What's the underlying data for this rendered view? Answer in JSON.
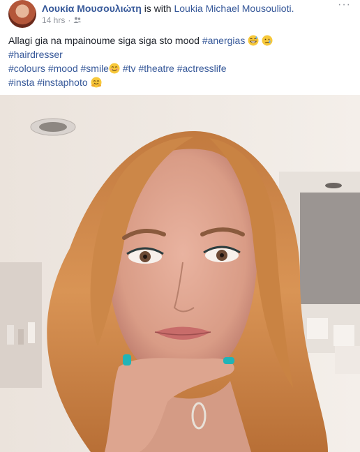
{
  "post": {
    "author_name": "Λουκία Μουσουλιώτη",
    "with_text": "is with",
    "tagged_name": "Loukia Michael Mousoulioti.",
    "timestamp": "14 hrs",
    "separator": "·",
    "privacy_icon": "friends-icon",
    "more_icon": "more-icon",
    "more_label": "···"
  },
  "text": {
    "line1_plain": "Allagi gia na mpainoume siga siga sto mood ",
    "line1_tag": "#anergias",
    "line1_emojis": [
      "grinning-sweat-emoji",
      "crying-emoji"
    ],
    "line2_tags": [
      "#hairdresser"
    ],
    "line3_tags": [
      "#colours",
      "#mood",
      "#smile"
    ],
    "line3_emoji": "smiling-emoji",
    "line3_more_tags": [
      "#tv",
      "#theatre",
      "#actresslife"
    ],
    "line4_tags": [
      "#insta",
      "#instaphoto"
    ],
    "line4_emoji": "hugging-emoji"
  },
  "photo": {
    "subject": "selfie-photo"
  },
  "colors": {
    "link": "#365899",
    "meta": "#90949c",
    "text": "#1d2129"
  }
}
